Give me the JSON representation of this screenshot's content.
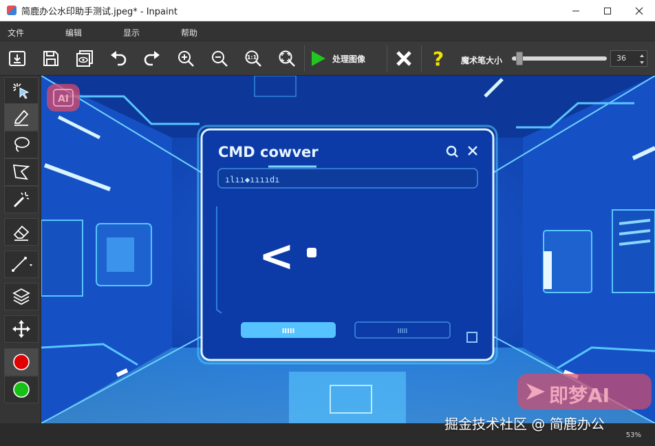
{
  "window": {
    "title": "简鹿办公水印助手测试.jpeg* - Inpaint",
    "minimize_icon": "minimize-icon",
    "maximize_icon": "maximize-icon",
    "close_icon": "close-icon"
  },
  "menu": {
    "items": [
      "文件",
      "编辑",
      "显示",
      "帮助"
    ]
  },
  "toolbar": {
    "process_label": "处理图像",
    "brush_size_label": "魔术笔大小",
    "brush_size_value": "36",
    "brush_size_level": 0.05,
    "icons": [
      "open-file-icon",
      "save-icon",
      "preview-icon",
      "undo-icon",
      "redo-icon",
      "zoom-in-icon",
      "zoom-out-icon",
      "actual-size-icon",
      "fit-window-icon",
      "process-play-icon",
      "cancel-x-icon",
      "help-icon"
    ],
    "colors": {
      "process_green": "#22c522",
      "help_yellow": "#f5e400",
      "cancel_white": "#ffffff"
    }
  },
  "left_tools": {
    "icons": [
      "select-arrow-icon",
      "marker-pen-icon",
      "lasso-icon",
      "polygon-lasso-icon",
      "magic-wand-icon",
      "eraser-icon",
      "line-icon",
      "layers-icon",
      "move-icon",
      "red-marker-icon",
      "green-marker-icon"
    ],
    "colors": {
      "red_marker": "#e00000",
      "green_marker": "#16c016"
    }
  },
  "canvas": {
    "image": {
      "ai_badge": "AI",
      "dialog_title": "CMD cowver",
      "dialog_input_text": "ılıı◆ııııdı",
      "prompt_symbol": "<",
      "button1_text": "IIIII",
      "button2_text": "IIIII",
      "stamp_text": "即梦AI"
    },
    "colors": {
      "bg_blue": "#0f3ea0",
      "glow_blue": "#4ec4ff",
      "dialog_fill": "#0c3aa6",
      "stamp_red": "#d84a6a"
    }
  },
  "status": {
    "zoom": "53%",
    "watermark": "掘金技术社区 @ 简鹿办公"
  }
}
